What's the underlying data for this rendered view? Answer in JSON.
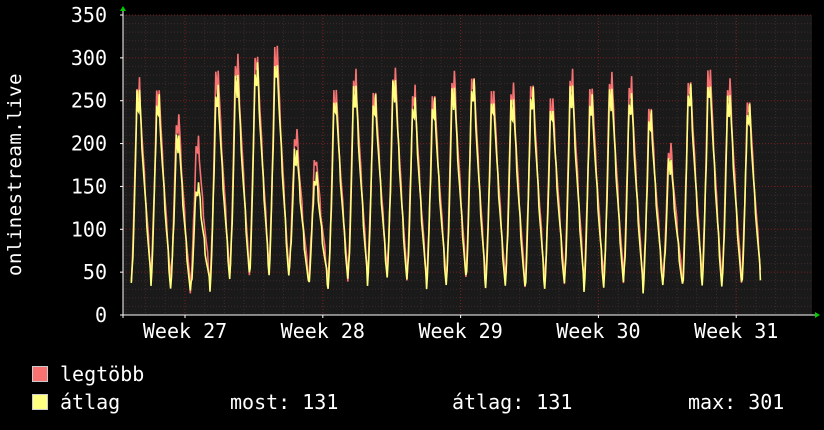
{
  "y_axis_label": "onlinestream.live",
  "legend": {
    "max_label": "legtöbb",
    "avg_label": "átlag"
  },
  "stats": {
    "now": "most: 131",
    "avg": "átlag: 131",
    "max": "max: 301"
  },
  "colors": {
    "background": "#000000",
    "plot_background": "#1a1a1a",
    "grid_major": "#7a1f1f",
    "grid_minor": "#3d2a2a",
    "axis": "#ffffff",
    "arrow": "#00cc00",
    "max_series": "#f87272",
    "avg_series": "#ffff80"
  },
  "chart_data": {
    "type": "line",
    "ylim": [
      0,
      350
    ],
    "xlim": [
      26.55,
      31.55
    ],
    "yticks": [
      0,
      50,
      100,
      150,
      200,
      250,
      300,
      350
    ],
    "xticks": [
      {
        "value": 27,
        "label": "Week 27"
      },
      {
        "value": 28,
        "label": "Week 28"
      },
      {
        "value": 29,
        "label": "Week 29"
      },
      {
        "value": 30,
        "label": "Week 30"
      },
      {
        "value": 31,
        "label": "Week 31"
      }
    ],
    "series": [
      {
        "name": "legtöbb",
        "color": "#f87272",
        "peaks": [
          275,
          268,
          235,
          205,
          290,
          305,
          310,
          318,
          215,
          185,
          265,
          285,
          265,
          290,
          265,
          260,
          285,
          285,
          265,
          270,
          275,
          255,
          285,
          270,
          285,
          275,
          245,
          200,
          280,
          290,
          275,
          255
        ],
        "troughs": [
          45,
          48,
          40,
          30,
          38,
          48,
          50,
          55,
          50,
          42,
          40,
          45,
          48,
          50,
          45,
          40,
          42,
          48,
          42,
          40,
          35,
          40,
          42,
          40,
          40,
          42,
          35,
          42,
          40,
          45,
          38,
          40
        ]
      },
      {
        "name": "átlag",
        "color": "#ffff80",
        "peaks": [
          265,
          255,
          215,
          155,
          265,
          285,
          295,
          300,
          195,
          165,
          255,
          270,
          255,
          280,
          255,
          250,
          270,
          275,
          255,
          255,
          265,
          245,
          270,
          255,
          270,
          260,
          235,
          185,
          270,
          275,
          260,
          245
        ],
        "troughs": [
          35,
          40,
          32,
          25,
          32,
          42,
          45,
          50,
          45,
          35,
          33,
          40,
          40,
          45,
          38,
          35,
          35,
          42,
          35,
          33,
          28,
          33,
          35,
          33,
          33,
          35,
          30,
          35,
          32,
          38,
          32,
          33
        ]
      }
    ]
  }
}
